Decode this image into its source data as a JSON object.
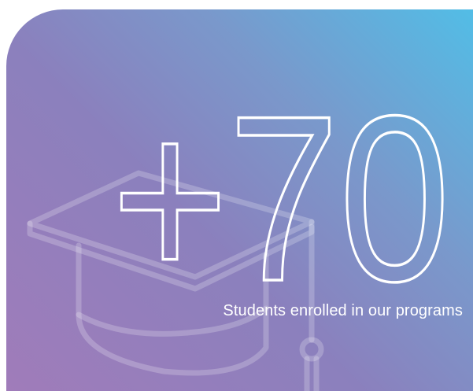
{
  "stat": {
    "number": "+70",
    "label": "Students enrolled in our programs"
  },
  "icons": {
    "background": "graduation-cap-icon"
  },
  "colors": {
    "gradient_start": "#52bde6",
    "gradient_mid": "#8b80bd",
    "gradient_end": "#a07cba",
    "text": "#ffffff"
  }
}
